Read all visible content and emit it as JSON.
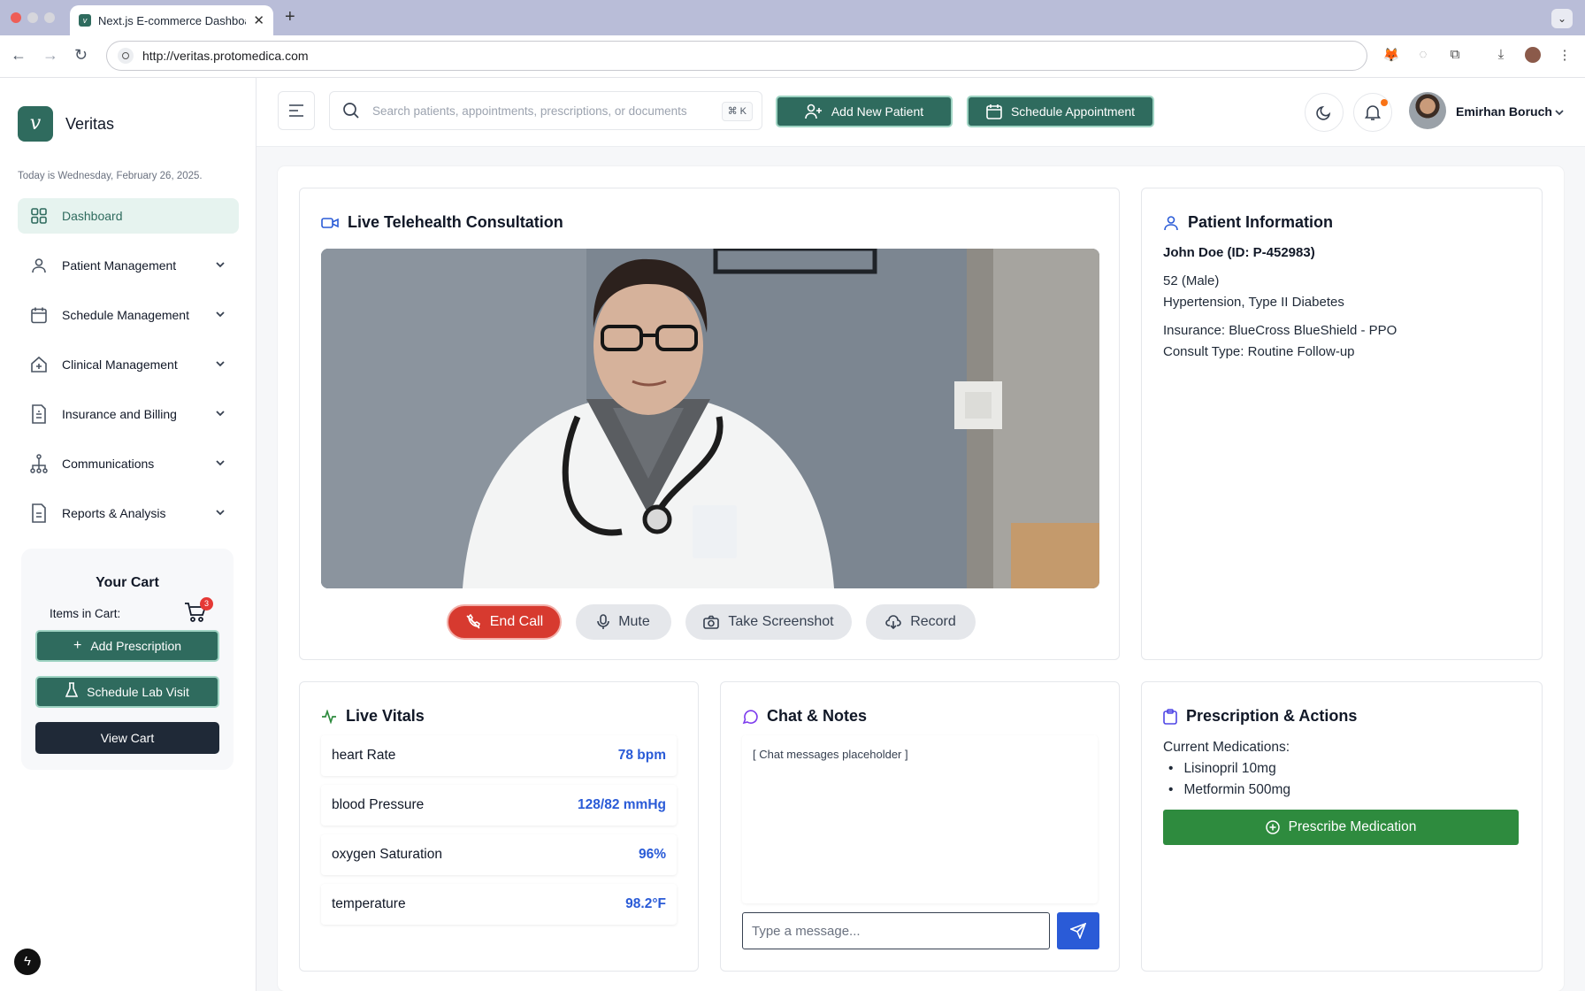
{
  "browser": {
    "tab_title": "Next.js E-commerce Dashboard",
    "url": "http://veritas.protomedica.com"
  },
  "sidebar": {
    "brand_name": "Veritas",
    "today": "Today is Wednesday, February 26, 2025.",
    "items": [
      {
        "label": "Dashboard",
        "icon": "grid-icon"
      },
      {
        "label": "Patient Management",
        "icon": "user-icon"
      },
      {
        "label": "Schedule Management",
        "icon": "calendar-icon"
      },
      {
        "label": "Clinical Management",
        "icon": "clinic-icon"
      },
      {
        "label": "Insurance and Billing",
        "icon": "invoice-icon"
      },
      {
        "label": "Communications",
        "icon": "network-icon"
      },
      {
        "label": "Reports & Analysis",
        "icon": "report-icon"
      }
    ],
    "cart": {
      "title": "Your Cart",
      "items_label": "Items in Cart:",
      "count": "3",
      "add_prescription": "Add Prescription",
      "schedule_lab": "Schedule Lab Visit",
      "view_cart": "View Cart"
    }
  },
  "header": {
    "search_placeholder": "Search patients, appointments, prescriptions, or documents",
    "shortcut": "⌘ K",
    "add_patient": "Add New Patient",
    "schedule_appointment": "Schedule Appointment",
    "user_name": "Emirhan Boruch"
  },
  "telehealth": {
    "title": "Live Telehealth Consultation",
    "end_call": "End Call",
    "mute": "Mute",
    "screenshot": "Take Screenshot",
    "record": "Record"
  },
  "patient": {
    "title": "Patient Information",
    "name_id": "John Doe (ID: P-452983)",
    "age_sex": "52 (Male)",
    "conditions": "Hypertension, Type II Diabetes",
    "insurance": "Insurance: BlueCross BlueShield - PPO",
    "consult_type": "Consult Type: Routine Follow-up"
  },
  "vitals": {
    "title": "Live Vitals",
    "rows": [
      {
        "label": "heart Rate",
        "value": "78 bpm"
      },
      {
        "label": "blood Pressure",
        "value": "128/82 mmHg"
      },
      {
        "label": "oxygen Saturation",
        "value": "96%"
      },
      {
        "label": "temperature",
        "value": "98.2°F"
      }
    ]
  },
  "chat": {
    "title": "Chat & Notes",
    "placeholder_text": "[ Chat messages placeholder ]",
    "input_placeholder": "Type a message..."
  },
  "prescription": {
    "title": "Prescription & Actions",
    "current_label": "Current Medications:",
    "meds": [
      "Lisinopril 10mg",
      "Metformin 500mg"
    ],
    "prescribe": "Prescribe Medication"
  },
  "colors": {
    "brand": "#2f6b5e",
    "danger": "#d73a2f",
    "value_blue": "#2a5bd7",
    "prescribe_green": "#2e8b3e"
  }
}
